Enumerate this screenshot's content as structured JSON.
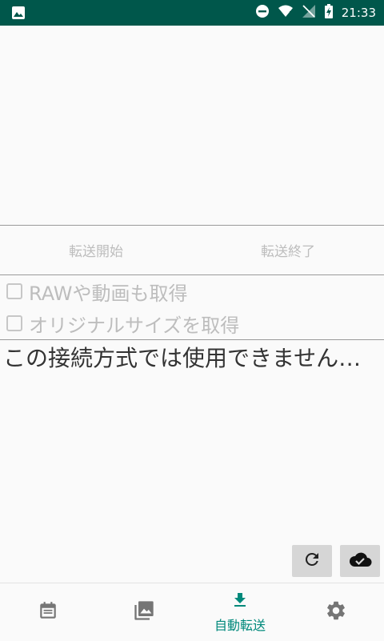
{
  "status_bar": {
    "time": "21:33"
  },
  "transfer": {
    "start_label": "転送開始",
    "end_label": "転送終了"
  },
  "options": [
    {
      "label": "RAWや動画も取得",
      "checked": false
    },
    {
      "label": "オリジナルサイズを取得",
      "checked": false
    }
  ],
  "message": "この接続方式では使用できません…",
  "actions": {
    "refresh_icon": "refresh-icon",
    "cloud_icon": "cloud-check-icon"
  },
  "bottom_nav": {
    "items": [
      {
        "icon": "calendar-icon",
        "label": ""
      },
      {
        "icon": "photo-library-icon",
        "label": ""
      },
      {
        "icon": "download-icon",
        "label": "自動転送",
        "active": true
      },
      {
        "icon": "gear-icon",
        "label": ""
      }
    ]
  },
  "colors": {
    "status_bar": "#00574b",
    "accent": "#00897b",
    "disabled_text": "#bdbdbd",
    "background": "#fafafa"
  }
}
